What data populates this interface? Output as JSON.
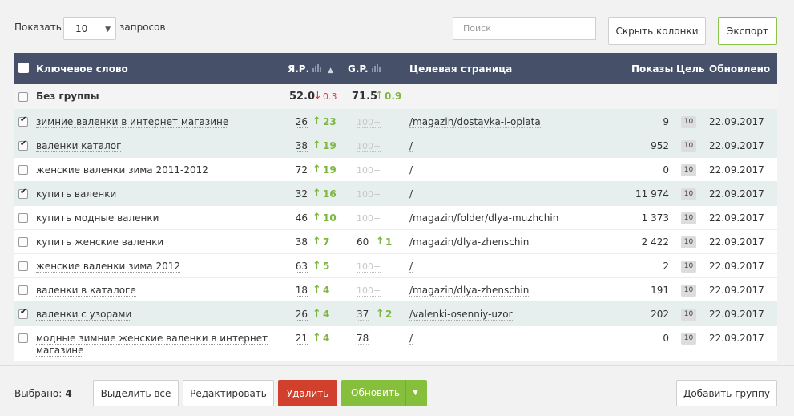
{
  "toolbar": {
    "show_label": "Показать",
    "per_page_value": "10",
    "requests_label": "запросов",
    "search_placeholder": "Поиск",
    "hide_columns_label": "Скрыть колонки",
    "export_label": "Экспорт"
  },
  "table": {
    "headers": {
      "keyword": "Ключевое слово",
      "yandex": "Я.Р.",
      "google": "G.P.",
      "target_page": "Целевая страница",
      "shows": "Показы",
      "goal": "Цель",
      "updated": "Обновлено"
    },
    "group": {
      "name": "Без группы",
      "yandex_value": "52.0",
      "yandex_arrow": "↓",
      "yandex_change": "0.3",
      "google_value": "71.5",
      "google_arrow": "↑",
      "google_change": "0.9"
    },
    "rows": [
      {
        "checked": true,
        "keyword": "зимние валенки в интернет магазине",
        "y_value": "26",
        "y_arrow": "↑",
        "y_change": "23",
        "g_value": "100+",
        "g_arrow": "",
        "g_change": "",
        "g_dim": true,
        "url": "/magazin/dostavka-i-oplata",
        "shows": "9",
        "goal": "10",
        "updated": "22.09.2017"
      },
      {
        "checked": true,
        "keyword": "валенки каталог",
        "y_value": "38",
        "y_arrow": "↑",
        "y_change": "19",
        "g_value": "100+",
        "g_arrow": "",
        "g_change": "",
        "g_dim": true,
        "url": "/",
        "shows": "952",
        "goal": "10",
        "updated": "22.09.2017"
      },
      {
        "checked": false,
        "keyword": "женские валенки зима 2011-2012",
        "y_value": "72",
        "y_arrow": "↑",
        "y_change": "19",
        "g_value": "100+",
        "g_arrow": "",
        "g_change": "",
        "g_dim": true,
        "url": "/",
        "shows": "0",
        "goal": "10",
        "updated": "22.09.2017"
      },
      {
        "checked": true,
        "keyword": "купить валенки",
        "y_value": "32",
        "y_arrow": "↑",
        "y_change": "16",
        "g_value": "100+",
        "g_arrow": "",
        "g_change": "",
        "g_dim": true,
        "url": "/",
        "shows": "11 974",
        "goal": "10",
        "updated": "22.09.2017"
      },
      {
        "checked": false,
        "keyword": "купить модные валенки",
        "y_value": "46",
        "y_arrow": "↑",
        "y_change": "10",
        "g_value": "100+",
        "g_arrow": "",
        "g_change": "",
        "g_dim": true,
        "url": "/magazin/folder/dlya-muzhchin",
        "shows": "1 373",
        "goal": "10",
        "updated": "22.09.2017"
      },
      {
        "checked": false,
        "keyword": "купить женские валенки",
        "y_value": "38",
        "y_arrow": "↑",
        "y_change": "7",
        "g_value": "60",
        "g_arrow": "↑",
        "g_change": "1",
        "g_dim": false,
        "url": "/magazin/dlya-zhenschin",
        "shows": "2 422",
        "goal": "10",
        "updated": "22.09.2017"
      },
      {
        "checked": false,
        "keyword": "женские валенки зима 2012",
        "y_value": "63",
        "y_arrow": "↑",
        "y_change": "5",
        "g_value": "100+",
        "g_arrow": "",
        "g_change": "",
        "g_dim": true,
        "url": "/",
        "shows": "2",
        "goal": "10",
        "updated": "22.09.2017"
      },
      {
        "checked": false,
        "keyword": "валенки в каталоге",
        "y_value": "18",
        "y_arrow": "↑",
        "y_change": "4",
        "g_value": "100+",
        "g_arrow": "",
        "g_change": "",
        "g_dim": true,
        "url": "/magazin/dlya-zhenschin",
        "shows": "191",
        "goal": "10",
        "updated": "22.09.2017"
      },
      {
        "checked": true,
        "keyword": "валенки с узорами",
        "y_value": "26",
        "y_arrow": "↑",
        "y_change": "4",
        "g_value": "37",
        "g_arrow": "↑",
        "g_change": "2",
        "g_dim": false,
        "url": "/valenki-osenniy-uzor",
        "shows": "202",
        "goal": "10",
        "updated": "22.09.2017"
      },
      {
        "checked": false,
        "keyword": "модные зимние женские валенки в интернет магазине",
        "y_value": "21",
        "y_arrow": "↑",
        "y_change": "4",
        "g_value": "78",
        "g_arrow": "",
        "g_change": "",
        "g_dim": false,
        "url": "/",
        "shows": "0",
        "goal": "10",
        "updated": "22.09.2017"
      }
    ]
  },
  "footer": {
    "selected_label": "Выбрано:",
    "selected_count": "4",
    "select_all_label": "Выделить все",
    "edit_label": "Редактировать",
    "delete_label": "Удалить",
    "update_label": "Обновить",
    "add_group_label": "Добавить группу"
  },
  "colors": {
    "header_bg": "#465069",
    "up_green": "#7db741",
    "down_red": "#d9383e",
    "delete_red": "#d0402c",
    "update_green": "#86bf3b",
    "selected_row": "#e7eeee"
  }
}
